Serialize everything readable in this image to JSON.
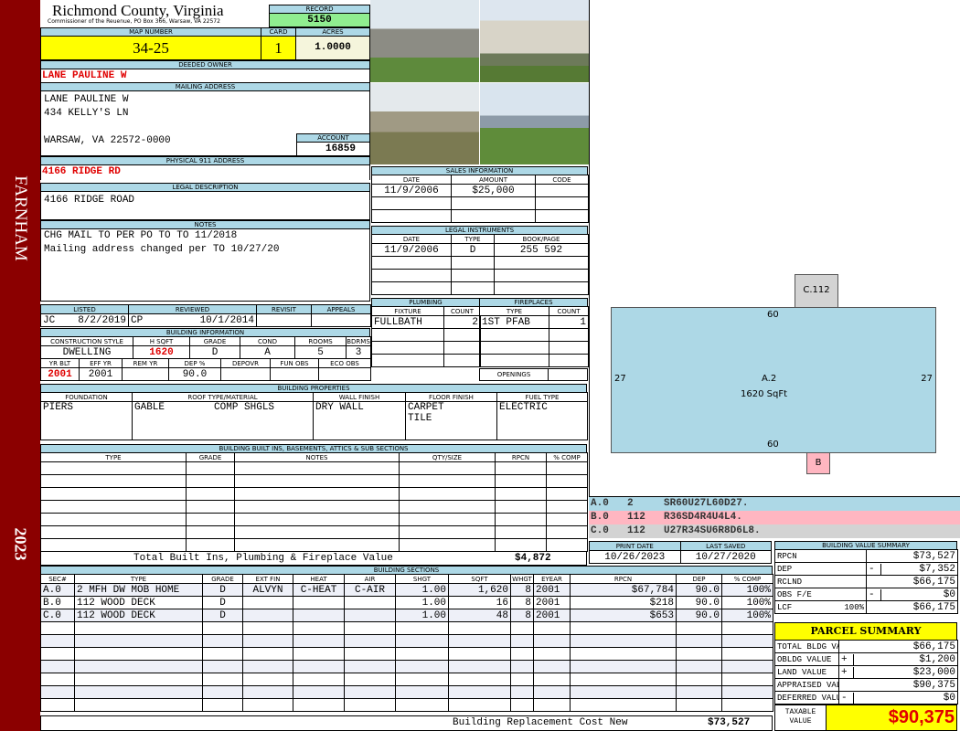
{
  "sidebar": {
    "district": "FARNHAM",
    "year": "2023",
    "color": "#8b0000"
  },
  "header": {
    "title": "Richmond County, Virginia",
    "subtitle": "Commissioner of the Reuenue, PO Box 366, Warsaw, VA 22572",
    "record_label": "RECORD",
    "record": "5150"
  },
  "parcel": {
    "map_label": "MAP NUMBER",
    "map_number": "34-25",
    "card_label": "CARD",
    "card": "1",
    "acres_label": "ACRES",
    "acres": "1.0000"
  },
  "owner": {
    "label": "DEEDED OWNER",
    "name": "LANE PAULINE W"
  },
  "mailing": {
    "label": "MAILING ADDRESS",
    "line1": "LANE PAULINE W",
    "line2": "434 KELLY'S LN",
    "line3": "WARSAW, VA 22572-0000",
    "account_label": "ACCOUNT",
    "account": "16859"
  },
  "physical": {
    "label": "PHYSICAL 911 ADDRESS",
    "value": "4166 RIDGE RD"
  },
  "legal": {
    "label": "LEGAL DESCRIPTION",
    "value": "4166 RIDGE ROAD"
  },
  "notes": {
    "label": "NOTES",
    "line1": "CHG MAIL TO PER PO TO TO 11/2018",
    "line2": "Mailing address changed per TO 10/27/20"
  },
  "listing": {
    "headers": [
      "LISTED",
      "REVIEWED",
      "REVISIT",
      "APPEALS"
    ],
    "listed_by": "JC",
    "listed_date": "8/2/2019",
    "reviewed_by": "CP",
    "reviewed_date": "10/1/2014"
  },
  "building_info": {
    "label": "BUILDING INFORMATION",
    "headers1": [
      "CONSTRUCTION STYLE",
      "H SQFT",
      "GRADE",
      "COND",
      "ROOMS",
      "BDRMS"
    ],
    "values1": [
      "DWELLING",
      "1620",
      "D",
      "A",
      "5",
      "3"
    ],
    "headers2": [
      "YR BLT",
      "EFF YR",
      "REM YR",
      "DEP %",
      "DEPOVR",
      "FUN OBS",
      "ECO OBS"
    ],
    "values2": [
      "2001",
      "2001",
      "",
      "90.0",
      "",
      "",
      ""
    ]
  },
  "sales": {
    "label": "SALES INFORMATION",
    "headers": [
      "DATE",
      "AMOUNT",
      "CODE"
    ],
    "rows": [
      [
        "11/9/2006",
        "$25,000",
        ""
      ]
    ]
  },
  "instruments": {
    "label": "LEGAL INSTRUMENTS",
    "headers": [
      "DATE",
      "TYPE",
      "BOOK/PAGE"
    ],
    "rows": [
      [
        "11/9/2006",
        "D",
        "255 592"
      ]
    ]
  },
  "plumbing": {
    "label": "PLUMBING",
    "headers": [
      "FIXTURE",
      "COUNT"
    ],
    "rows": [
      [
        "FULLBATH",
        "2"
      ]
    ]
  },
  "fireplaces": {
    "label": "FIREPLACES",
    "headers": [
      "TYPE",
      "COUNT"
    ],
    "rows": [
      [
        "1ST PFAB",
        "1"
      ]
    ],
    "openings_label": "OPENINGS"
  },
  "properties": {
    "label": "BUILDING PROPERTIES",
    "headers": [
      "FOUNDATION",
      "ROOF TYPE/MATERIAL",
      "WALL FINISH",
      "FLOOR FINISH",
      "FUEL TYPE"
    ],
    "foundation": "PIERS",
    "roof_type": "GABLE",
    "roof_material": "COMP SHGLS",
    "wall": "DRY WALL",
    "floor1": "CARPET",
    "floor2": "TILE",
    "fuel": "ELECTRIC"
  },
  "builtins": {
    "label": "BUILDING BUILT INS, BASEMENTS, ATTICS & SUB SECTIONS",
    "headers": [
      "TYPE",
      "GRADE",
      "NOTES",
      "QTY/SIZE",
      "RPCN",
      "% COMP"
    ],
    "total_label": "Total Built Ins, Plumbing & Fireplace Value",
    "total": "$4,872"
  },
  "dates": {
    "print_label": "PRINT DATE",
    "print": "10/26/2023",
    "saved_label": "LAST SAVED",
    "saved": "10/27/2020"
  },
  "sections": {
    "label": "BUILDING SECTIONS",
    "headers": [
      "SEC#",
      "TYPE",
      "GRADE",
      "EXT FIN",
      "HEAT",
      "AIR",
      "SHGT",
      "SQFT",
      "WHGT",
      "EYEAR",
      "RPCN",
      "DEP",
      "% COMP"
    ],
    "rows": [
      [
        "A.0",
        "2 MFH DW MOB HOME",
        "D",
        "ALVYN",
        "C-HEAT",
        "C-AIR",
        "1.00",
        "1,620",
        "8",
        "2001",
        "$67,784",
        "90.0",
        "100%"
      ],
      [
        "B.0",
        "112 WOOD DECK",
        "D",
        "",
        "",
        "",
        "1.00",
        "16",
        "8",
        "2001",
        "$218",
        "90.0",
        "100%"
      ],
      [
        "C.0",
        "112 WOOD DECK",
        "D",
        "",
        "",
        "",
        "1.00",
        "48",
        "8",
        "2001",
        "$653",
        "90.0",
        "100%"
      ]
    ],
    "total_label": "Building Replacement Cost New",
    "total": "$73,527"
  },
  "sketch": {
    "main_label": "A.2",
    "main_area": "1620 SqFt",
    "top": "60",
    "bottom": "60",
    "left": "27",
    "right": "27",
    "c_label": "C.112",
    "b_label": "B",
    "legend": [
      [
        "A.0",
        "2",
        "SR60U27L60D27.",
        "#add8e6"
      ],
      [
        "B.0",
        "112",
        "R36SD4R4U4L4.",
        "#ffb6c1"
      ],
      [
        "C.0",
        "112",
        "U27R34SU6R8D6L8.",
        "#d3d3d3"
      ]
    ]
  },
  "value_summary": {
    "label": "BUILDING VALUE SUMMARY",
    "rows": [
      [
        "RPCN",
        "",
        "",
        "$73,527"
      ],
      [
        "DEP",
        "",
        "-",
        "$7,352"
      ],
      [
        "RCLND",
        "",
        "",
        "$66,175"
      ],
      [
        "OBS F/E",
        "",
        "-",
        "$0"
      ],
      [
        "LCF",
        "100%",
        "",
        "$66,175"
      ]
    ]
  },
  "parcel_summary": {
    "label": "PARCEL SUMMARY",
    "rows": [
      [
        "TOTAL BLDG VALUE",
        "",
        "$66,175"
      ],
      [
        "OBLDG VALUE",
        "+",
        "$1,200"
      ],
      [
        "LAND VALUE",
        "+",
        "$23,000"
      ],
      [
        "APPRAISED VALUE",
        "",
        "$90,375"
      ],
      [
        "DEFERRED VALUE",
        "-",
        "$0"
      ]
    ],
    "taxable_label": "TAXABLE VALUE",
    "taxable": "$90,375"
  }
}
